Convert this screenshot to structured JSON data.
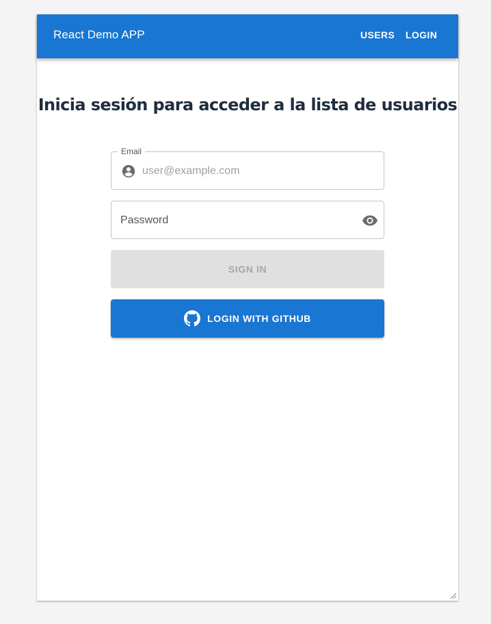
{
  "appbar": {
    "title": "React Demo APP",
    "nav": [
      {
        "label": "USERS"
      },
      {
        "label": "LOGIN"
      }
    ]
  },
  "main": {
    "heading": "Inicia sesión para acceder a la lista de usuarios",
    "email": {
      "label": "Email",
      "placeholder": "user@example.com",
      "value": "",
      "icon": "account-circle-icon"
    },
    "password": {
      "placeholder": "Password",
      "value": "",
      "icon": "eye-icon"
    },
    "signin_label": "SIGN IN",
    "github_label": "LOGIN WITH GITHUB"
  },
  "colors": {
    "primary": "#1976d2",
    "disabled_bg": "#e0e0e0",
    "disabled_text": "#a6a6a6",
    "heading": "#1f2d3d"
  }
}
